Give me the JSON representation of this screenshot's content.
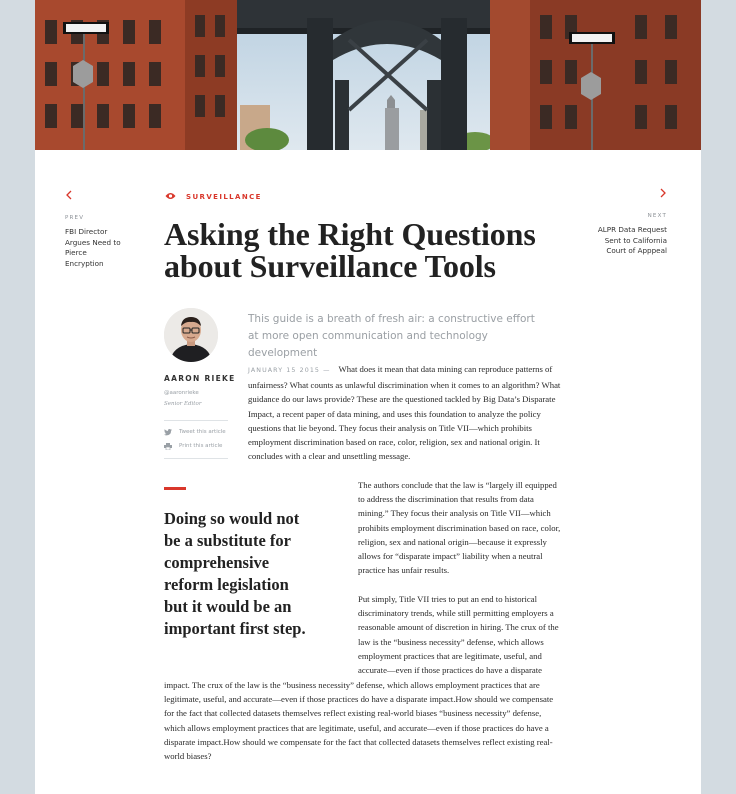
{
  "colors": {
    "accent": "#d9372b",
    "page_background": "#d3dbe1",
    "muted_text": "#9aa0a6"
  },
  "hero": {
    "icon": "brooklyn-bridge-photo"
  },
  "nav": {
    "prev": {
      "icon": "chevron-left-icon",
      "label": "PREV",
      "title": "FBI Director Argues Need to Pierce Encryption"
    },
    "next": {
      "icon": "chevron-right-icon",
      "label": "NEXT",
      "title": "ALPR Data Request Sent to California Court of Apppeal"
    }
  },
  "article": {
    "category": "SURVEILLANCE",
    "category_icon": "eye-icon",
    "title": "Asking the Right Questions about Surveillance Tools",
    "lead": "This guide is a breath of fresh air: a constructive effort at more open communication and technology development",
    "date": "JANUARY 15 2015 —",
    "paragraphs": [
      "What does it mean that data mining can reproduce patterns of unfairness? What counts as unlawful discrimination when it comes to an algorithm? What guidance do our laws provide? These are the questioned tackled by Big Data’s Disparate Impact, a recent paper of data mining, and uses this foundation to analyze the policy questions that lie beyond. They focus their analysis on Title VII—which prohibits employment discrimination based on race, color, religion, sex and national origin. It concludes with a clear and unsettling message.",
      "The authors conclude that the law is “largely ill equipped to address the discrimination that results from data mining.” They focus their analysis on Title VII—which prohibits employment discrimination based on race, color, religion, sex and national origin—because it expressly allows for “disparate impact” liability when a neutral practice has unfair results.",
      "Put simply, Title VII tries to put an end to historical discriminatory trends, while still permitting employers a reasonable amount of discretion in hiring. The crux of the law is the “business necessity” defense, which allows employment practices that are legitimate, useful, and accurate—even if those practices do have a disparate",
      "impact. The crux of the law is the “business necessity” defense, which allows employment practices that are legitimate, useful, and accurate—even if those practices do have a disparate impact.How should we compensate for the fact that collected datasets themselves reflect existing real-world biases “business necessity” defense, which allows employment practices that are legitimate, useful, and accurate—even if those practices do have a disparate impact.How should we compensate for the fact that collected datasets themselves reflect existing real-world biases?"
    ],
    "pull_quote": "Doing so would not be a substitute for comprehensive reform legislation but it would be an important first step."
  },
  "author": {
    "avatar_icon": "author-avatar",
    "name": "AARON RIEKE",
    "handle": "@aaronrieke",
    "role": "Senior Editor",
    "share": [
      {
        "icon": "twitter-icon",
        "label": "Tweet this article"
      },
      {
        "icon": "printer-icon",
        "label": "Print this article"
      }
    ]
  }
}
